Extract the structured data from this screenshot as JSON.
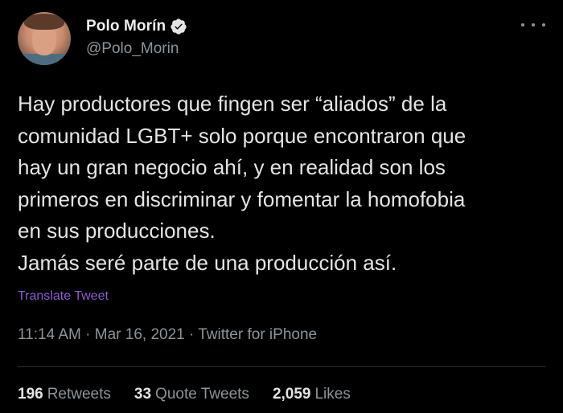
{
  "author": {
    "display_name": "Polo Morín",
    "handle": "@Polo_Morin",
    "verified_icon": "verified-badge-icon"
  },
  "tweet": {
    "text": "Hay productores que fingen ser “aliados” de la\ncomunidad LGBT+ solo porque encontraron que\nhay un gran negocio ahí, y en realidad son los\nprimeros en discriminar y fomentar la homofobia\nen sus producciones.\nJamás seré parte de una producción así.",
    "translate_label": "Translate Tweet",
    "timestamp": "11:14 AM · Mar 16, 2021 · Twitter for iPhone"
  },
  "stats": {
    "retweets_count": "196",
    "retweets_label": "Retweets",
    "quotes_count": "33",
    "quotes_label": "Quote Tweets",
    "likes_count": "2,059",
    "likes_label": "Likes"
  },
  "colors": {
    "background": "#000000",
    "text": "#e4e4e4",
    "secondary": "#8b949a",
    "translate_link": "#8d5bd6"
  }
}
